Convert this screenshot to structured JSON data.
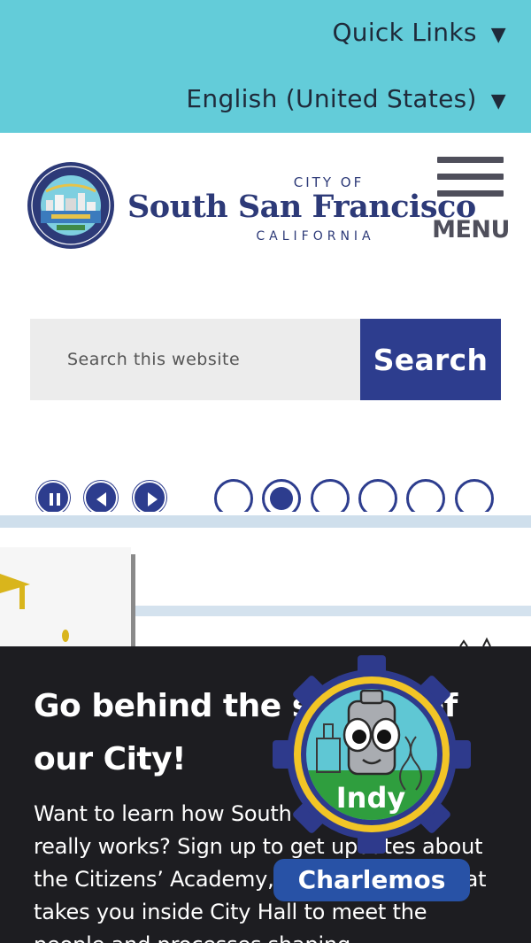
{
  "topbar": {
    "quick_links": "Quick Links",
    "language": "English (United States)",
    "caret_icon": "triangle-down-icon",
    "bg_color": "#63ccd9"
  },
  "logo": {
    "city_of": "CITY OF",
    "name": "South San Francisco",
    "state": "CALIFORNIA",
    "seal_icon": "city-seal-icon",
    "color": "#2d3a78"
  },
  "menu": {
    "label": "MENU",
    "icon": "hamburger-icon"
  },
  "search": {
    "placeholder": "Search this website",
    "button_label": "Search",
    "button_color": "#2d3d8e"
  },
  "carousel": {
    "controls": [
      "pause-icon",
      "previous-icon",
      "next-icon"
    ],
    "slide_count": 6,
    "active_slide": 2
  },
  "panel": {
    "heading": "Go behind the scenes of our City!",
    "body": "Want to learn how South San Francisco really works? Sign up to get updates about the Citizens’ Academy, a free program that takes you inside City Hall to meet the people and processes shaping"
  },
  "chatbot": {
    "name": "Indy",
    "cta": "Charlemos",
    "accent": "#f2c526",
    "badge_color": "#2e3a8c"
  }
}
